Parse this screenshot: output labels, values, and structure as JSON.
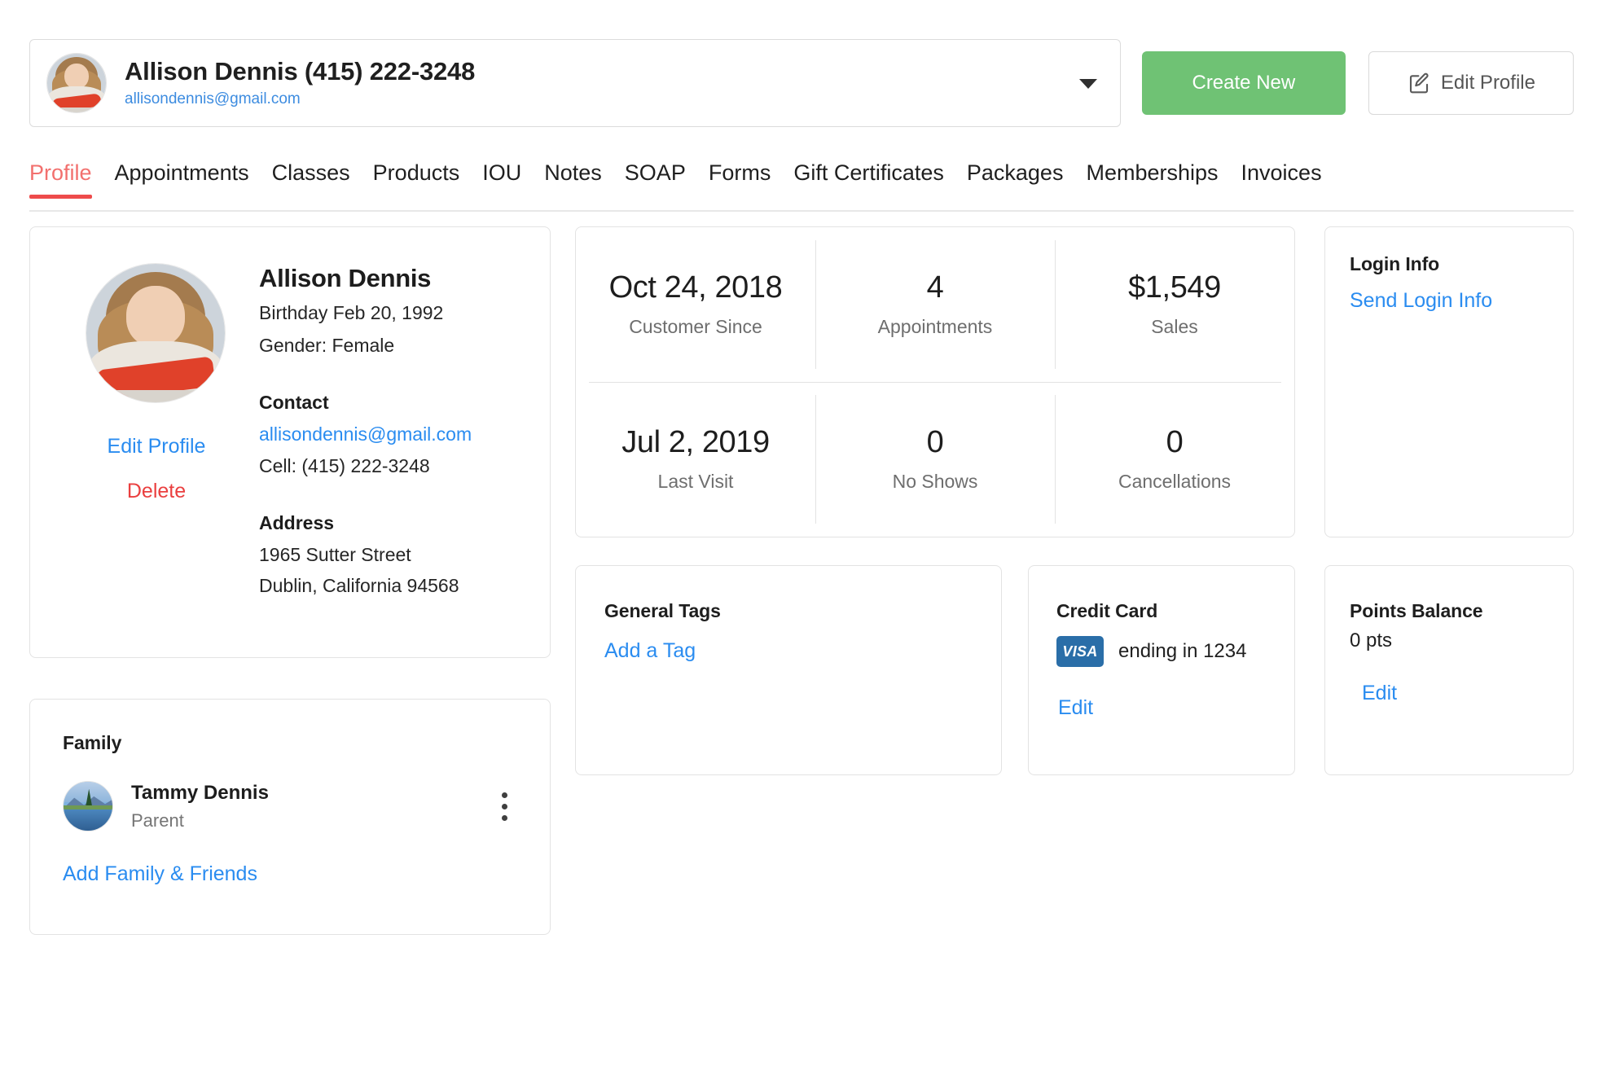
{
  "header": {
    "customer_name_phone": "Allison Dennis (415) 222-3248",
    "customer_email": "allisondennis@gmail.com",
    "dropdown_icon": "chevron-down-icon",
    "create_new_label": "Create New",
    "edit_profile_label": "Edit Profile",
    "edit_profile_icon": "pencil-square-icon",
    "accent_green": "#6fc274",
    "link_blue": "#2a8cf0"
  },
  "tabs": {
    "active": "Profile",
    "active_color": "#f2706e",
    "underline_color": "#ee4b4b",
    "items": [
      {
        "label": "Profile"
      },
      {
        "label": "Appointments"
      },
      {
        "label": "Classes"
      },
      {
        "label": "Products"
      },
      {
        "label": "IOU"
      },
      {
        "label": "Notes"
      },
      {
        "label": "SOAP"
      },
      {
        "label": "Forms"
      },
      {
        "label": "Gift Certificates"
      },
      {
        "label": "Packages"
      },
      {
        "label": "Memberships"
      },
      {
        "label": "Invoices"
      }
    ]
  },
  "profile_card": {
    "avatar_icon": "customer-portrait-avatar",
    "name": "Allison Dennis",
    "birthday": "Birthday Feb 20, 1992",
    "gender": "Gender: Female",
    "contact_heading": "Contact",
    "contact_email": "allisondennis@gmail.com",
    "contact_cell": "Cell: (415) 222-3248",
    "address_heading": "Address",
    "address_line1": "1965 Sutter Street",
    "address_line2": "Dublin, California 94568",
    "edit_profile_label": "Edit Profile",
    "delete_label": "Delete",
    "delete_color": "#ea3f3f"
  },
  "family_card": {
    "title": "Family",
    "members": [
      {
        "name": "Tammy Dennis",
        "relationship": "Parent",
        "avatar_icon": "landscape-photo-avatar",
        "menu_icon": "kebab-menu-icon"
      }
    ],
    "add_label": "Add Family & Friends"
  },
  "stats_card": {
    "cells": [
      {
        "value": "Oct 24, 2018",
        "label": "Customer Since"
      },
      {
        "value": "4",
        "label": "Appointments"
      },
      {
        "value": "$1,549",
        "label": "Sales"
      },
      {
        "value": "Jul 2, 2019",
        "label": "Last Visit"
      },
      {
        "value": "0",
        "label": "No Shows"
      },
      {
        "value": "0",
        "label": "Cancellations"
      }
    ]
  },
  "login_card": {
    "title": "Login Info",
    "send_label": "Send Login Info"
  },
  "tags_card": {
    "title": "General Tags",
    "add_label": "Add a Tag"
  },
  "credit_card": {
    "title": "Credit Card",
    "brand_label": "VISA",
    "brand_color": "#2a6ea8",
    "ending_text": "ending in 1234",
    "edit_label": "Edit"
  },
  "points_card": {
    "title": "Points Balance",
    "balance": "0 pts",
    "edit_label": "Edit"
  }
}
